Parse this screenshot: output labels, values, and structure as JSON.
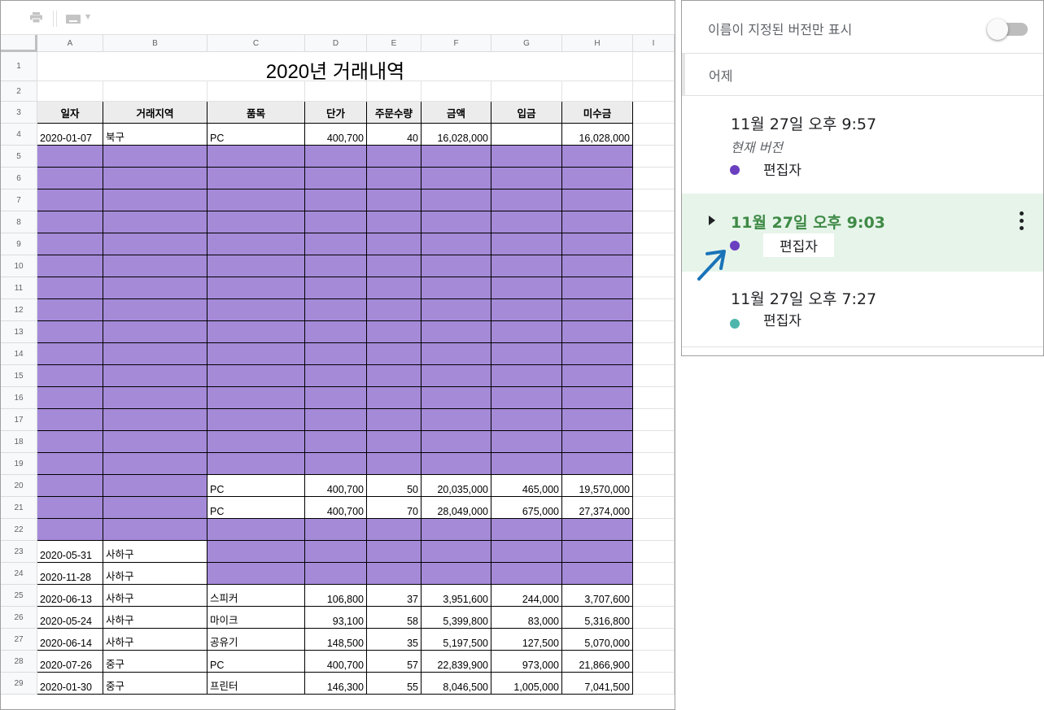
{
  "sheet": {
    "title": "2020년 거래내역",
    "columns": [
      "A",
      "B",
      "C",
      "D",
      "E",
      "F",
      "G",
      "H",
      "I"
    ],
    "headers": [
      "일자",
      "거래지역",
      "품목",
      "단가",
      "주문수량",
      "금액",
      "입금",
      "미수금"
    ],
    "rows": [
      {
        "num": "1"
      },
      {
        "num": "2"
      },
      {
        "num": "3"
      },
      {
        "num": "4",
        "cells": [
          "2020-01-07",
          "북구",
          "PC",
          "400,700",
          "40",
          "16,028,000",
          "",
          "16,028,000"
        ]
      },
      {
        "num": "5"
      },
      {
        "num": "6"
      },
      {
        "num": "7"
      },
      {
        "num": "8"
      },
      {
        "num": "9"
      },
      {
        "num": "10"
      },
      {
        "num": "11"
      },
      {
        "num": "12"
      },
      {
        "num": "13"
      },
      {
        "num": "14"
      },
      {
        "num": "15"
      },
      {
        "num": "16"
      },
      {
        "num": "17"
      },
      {
        "num": "18"
      },
      {
        "num": "19"
      },
      {
        "num": "20",
        "cells": [
          "",
          "",
          "PC",
          "400,700",
          "50",
          "20,035,000",
          "465,000",
          "19,570,000"
        ]
      },
      {
        "num": "21",
        "cells": [
          "",
          "",
          "PC",
          "400,700",
          "70",
          "28,049,000",
          "675,000",
          "27,374,000"
        ]
      },
      {
        "num": "22"
      },
      {
        "num": "23",
        "cells": [
          "2020-05-31",
          "사하구",
          "",
          "",
          "",
          "",
          "",
          ""
        ]
      },
      {
        "num": "24",
        "cells": [
          "2020-11-28",
          "사하구",
          "",
          "",
          "",
          "",
          "",
          ""
        ]
      },
      {
        "num": "25",
        "cells": [
          "2020-06-13",
          "사하구",
          "스피커",
          "106,800",
          "37",
          "3,951,600",
          "244,000",
          "3,707,600"
        ]
      },
      {
        "num": "26",
        "cells": [
          "2020-05-24",
          "사하구",
          "마이크",
          "93,100",
          "58",
          "5,399,800",
          "83,000",
          "5,316,800"
        ]
      },
      {
        "num": "27",
        "cells": [
          "2020-06-14",
          "사하구",
          "공유기",
          "148,500",
          "35",
          "5,197,500",
          "127,500",
          "5,070,000"
        ]
      },
      {
        "num": "28",
        "cells": [
          "2020-07-26",
          "중구",
          "PC",
          "400,700",
          "57",
          "22,839,900",
          "973,000",
          "21,866,900"
        ]
      },
      {
        "num": "29",
        "cells": [
          "2020-01-30",
          "중구",
          "프린터",
          "146,300",
          "55",
          "8,046,500",
          "1,005,000",
          "7,041,500"
        ]
      }
    ]
  },
  "history": {
    "named_only_label": "이름이 지정된 버전만 표시",
    "toggle_on": false,
    "section_label": "어제",
    "versions": [
      {
        "time": "11월 27일 오후 9:57",
        "sub": "현재 버전",
        "editor": "편집자",
        "dot_color": "#6a3fc0"
      },
      {
        "time": "11월 27일 오후 9:03",
        "editor": "편집자",
        "dot_color": "#6a3fc0",
        "selected": true
      },
      {
        "time": "11월 27일 오후 7:27",
        "editor": "편집자",
        "dot_color": "#4db6ac"
      }
    ]
  },
  "colors": {
    "purple_fill": "#a58ad8",
    "selected_version_bg": "#e6f4ea",
    "selected_version_text": "#3f8a46",
    "arrow": "#1a73b8"
  },
  "icons": {
    "toolbar": [
      "print-icon",
      "keyboard-icon"
    ],
    "version_row": [
      "expand-arrow-icon",
      "more-vert-icon"
    ],
    "annotation": "pointer-arrow-icon"
  }
}
